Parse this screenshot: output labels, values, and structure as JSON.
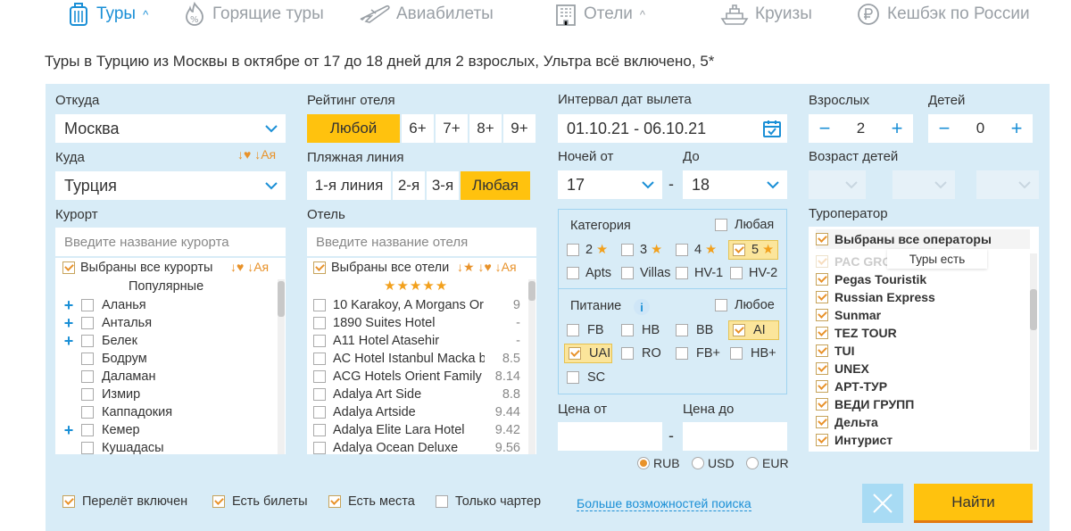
{
  "nav": {
    "tours": "Туры",
    "hot_tours": "Горящие туры",
    "flights": "Авиабилеты",
    "hotels": "Отели",
    "cruises": "Круизы",
    "cashback": "Кешбэк по России"
  },
  "heading": "Туры в Турцию из Москвы в октябре от 17 до 18 дней для 2 взрослых, Ультра всё включено, 5*",
  "search": {
    "from_label": "Откуда",
    "from_value": "Москва",
    "to_label": "Куда",
    "to_value": "Турция",
    "to_sort_icons": "↓♥ ↓Ая",
    "resort_label": "Курорт",
    "resort_placeholder": "Введите название курорта",
    "resort_all": "Выбраны все курорты",
    "resort_sort_icons": "↓♥ ↓Ая",
    "resort_popular": "Популярные",
    "resorts": [
      {
        "name": "Аланья",
        "expand": "+"
      },
      {
        "name": "Анталья",
        "expand": "+"
      },
      {
        "name": "Белек",
        "expand": "+"
      },
      {
        "name": "Бодрум",
        "expand": ""
      },
      {
        "name": "Даламан",
        "expand": ""
      },
      {
        "name": "Измир",
        "expand": ""
      },
      {
        "name": "Каппадокия",
        "expand": ""
      },
      {
        "name": "Кемер",
        "expand": "+"
      },
      {
        "name": "Кушадасы",
        "expand": ""
      }
    ],
    "rating_label": "Рейтинг отеля",
    "rating_options": [
      "Любой",
      "6+",
      "7+",
      "8+",
      "9+"
    ],
    "rating_selected": "Любой",
    "beach_label": "Пляжная линия",
    "beach_options": [
      "1-я линия",
      "2-я",
      "3-я",
      "Любая"
    ],
    "beach_selected": "Любая",
    "hotel_label": "Отель",
    "hotel_placeholder": "Введите название отеля",
    "hotel_all": "Выбраны все отели",
    "hotel_sort_icons": "↓★ ↓♥ ↓Ая",
    "hotel_stars": "★★★★★",
    "hotels": [
      {
        "name": "10 Karakoy, A Morgans Or",
        "rating": "9"
      },
      {
        "name": "1890 Suites Hotel",
        "rating": "-"
      },
      {
        "name": "A11 Hotel Atasehir",
        "rating": "-"
      },
      {
        "name": "AC Hotel Istanbul Macka b",
        "rating": "8.5"
      },
      {
        "name": "ACG Hotels Orient Family",
        "rating": "8.14"
      },
      {
        "name": "Adalya Art Side",
        "rating": "8.8"
      },
      {
        "name": "Adalya Artside",
        "rating": "9.44"
      },
      {
        "name": "Adalya Elite Lara Hotel",
        "rating": "9.42"
      },
      {
        "name": "Adalya Ocean Deluxe",
        "rating": "9.56"
      }
    ],
    "dates_label": "Интервал дат вылета",
    "dates_value": "01.10.21 - 06.10.21",
    "nights_from_label": "Ночей от",
    "nights_from": "17",
    "nights_to_label": "До",
    "nights_to": "18",
    "dash": "-",
    "category_label": "Категория",
    "category_any": "Любая",
    "categories": [
      {
        "label": "2",
        "checked": false
      },
      {
        "label": "3",
        "checked": false
      },
      {
        "label": "4",
        "checked": false
      },
      {
        "label": "5",
        "checked": true
      },
      {
        "label": "Apts",
        "checked": false
      },
      {
        "label": "Villas",
        "checked": false
      },
      {
        "label": "HV-1",
        "checked": false
      },
      {
        "label": "HV-2",
        "checked": false
      }
    ],
    "meal_label": "Питание",
    "meal_info": "i",
    "meal_any": "Любое",
    "meals": [
      {
        "label": "FB",
        "checked": false
      },
      {
        "label": "HB",
        "checked": false
      },
      {
        "label": "BB",
        "checked": false
      },
      {
        "label": "AI",
        "checked": true
      },
      {
        "label": "UAI",
        "checked": true
      },
      {
        "label": "RO",
        "checked": false
      },
      {
        "label": "FB+",
        "checked": false
      },
      {
        "label": "HB+",
        "checked": false
      },
      {
        "label": "SC",
        "checked": false
      }
    ],
    "price_from_label": "Цена от",
    "price_to_label": "Цена до",
    "currencies": [
      {
        "label": "RUB",
        "selected": true
      },
      {
        "label": "USD",
        "selected": false
      },
      {
        "label": "EUR",
        "selected": false
      }
    ],
    "adults_label": "Взрослых",
    "adults_value": "2",
    "children_label": "Детей",
    "children_value": "0",
    "minus": "−",
    "plus": "+",
    "child_age_label": "Возраст детей",
    "operator_label": "Туроператор",
    "operators_all": "Выбраны все операторы",
    "operators_faded": "PAC GROUP",
    "tooltip": "Туры есть",
    "operators": [
      "Pegas Touristik",
      "Russian Express",
      "Sunmar",
      "TEZ TOUR",
      "TUI",
      "UNEX",
      "АРТ-ТУР",
      "ВЕДИ ГРУПП",
      "Дельта",
      "Интурист"
    ]
  },
  "footer": {
    "options": [
      {
        "label": "Перелёт включен",
        "checked": true
      },
      {
        "label": "Есть билеты",
        "checked": true
      },
      {
        "label": "Есть места",
        "checked": true
      },
      {
        "label": "Только чартер",
        "checked": false
      }
    ],
    "more_link": "Больше возможностей поиска",
    "find_button": "Найти"
  },
  "colors": {
    "accent": "#1a8fd6",
    "panel_bg": "#d8ecf7",
    "yellow": "#ffc20e",
    "star": "#f2a01c"
  }
}
